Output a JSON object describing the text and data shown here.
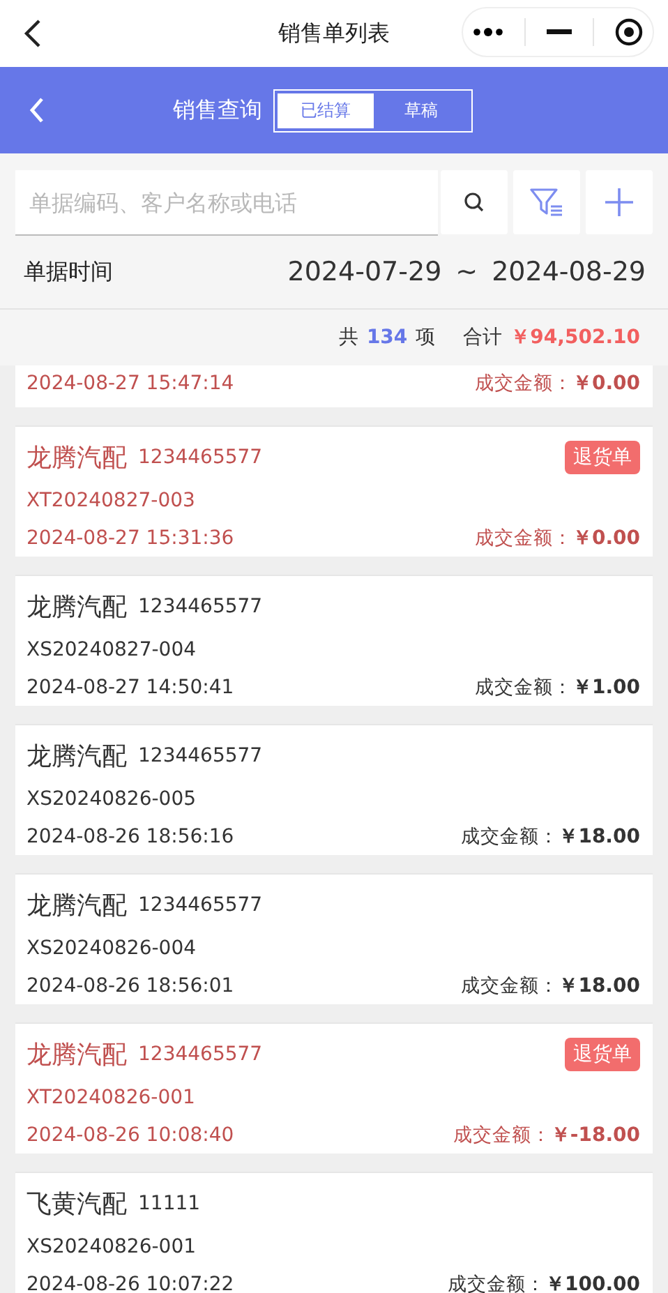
{
  "top_bar": {
    "title": "销售单列表"
  },
  "header": {
    "title": "销售查询",
    "tabs": [
      {
        "label": "已结算",
        "selected": true
      },
      {
        "label": "草稿",
        "selected": false
      }
    ]
  },
  "search": {
    "placeholder": "单据编码、客户名称或电话"
  },
  "date_filter": {
    "label": "单据时间",
    "start": "2024-07-29",
    "separator": "~",
    "end": "2024-08-29"
  },
  "summary": {
    "count_prefix": "共",
    "count": "134",
    "count_suffix": "项",
    "total_label": "合计",
    "total": "￥94,502.10"
  },
  "orders": [
    {
      "kind": "return",
      "time": "2024-08-27 15:47:14",
      "amount_label": "成交金额：",
      "amount": "￥0.00"
    },
    {
      "kind": "return",
      "customer": "龙腾汽配",
      "phone": "1234465577",
      "badge": "退货单",
      "code": "XT20240827-003",
      "time": "2024-08-27 15:31:36",
      "amount_label": "成交金额：",
      "amount": "￥0.00"
    },
    {
      "kind": "sale",
      "customer": "龙腾汽配",
      "phone": "1234465577",
      "code": "XS20240827-004",
      "time": "2024-08-27 14:50:41",
      "amount_label": "成交金额：",
      "amount": "￥1.00"
    },
    {
      "kind": "sale",
      "customer": "龙腾汽配",
      "phone": "1234465577",
      "code": "XS20240826-005",
      "time": "2024-08-26 18:56:16",
      "amount_label": "成交金额：",
      "amount": "￥18.00"
    },
    {
      "kind": "sale",
      "customer": "龙腾汽配",
      "phone": "1234465577",
      "code": "XS20240826-004",
      "time": "2024-08-26 18:56:01",
      "amount_label": "成交金额：",
      "amount": "￥18.00"
    },
    {
      "kind": "return",
      "customer": "龙腾汽配",
      "phone": "1234465577",
      "badge": "退货单",
      "code": "XT20240826-001",
      "time": "2024-08-26 10:08:40",
      "amount_label": "成交金额：",
      "amount": "￥-18.00"
    },
    {
      "kind": "sale",
      "customer": "飞黄汽配",
      "phone": "11111",
      "code": "XS20240826-001",
      "time": "2024-08-26 10:07:22",
      "amount_label": "成交金额：",
      "amount": "￥100.00"
    }
  ]
}
